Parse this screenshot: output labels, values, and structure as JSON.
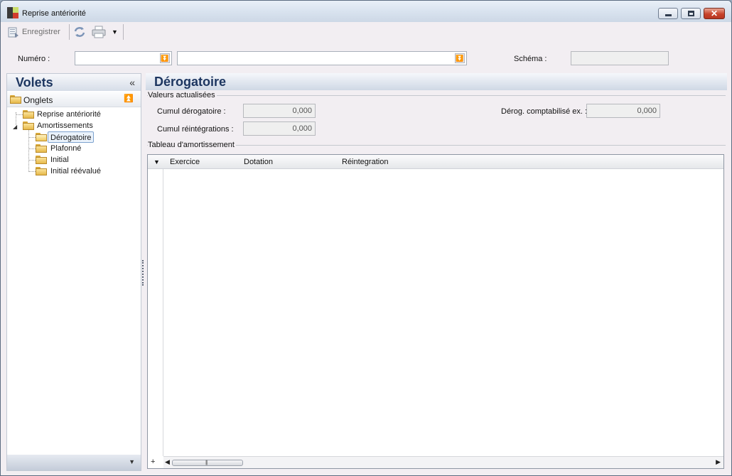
{
  "window": {
    "title": "Reprise antériorité"
  },
  "toolbar": {
    "save_label": "Enregistrer"
  },
  "header": {
    "numero_label": "Numéro :",
    "numero_value": "",
    "numero_desc_value": "",
    "schema_label": "Schéma :",
    "schema_value": ""
  },
  "left_panel": {
    "title": "Volets",
    "tabs_label": "Onglets",
    "tree": {
      "root1": "Reprise antériorité",
      "root2": "Amortissements",
      "children": [
        "Dérogatoire",
        "Plafonné",
        "Initial",
        "Initial réévalué"
      ],
      "selected": "Dérogatoire"
    }
  },
  "main": {
    "title": "Dérogatoire",
    "values_group": "Valeurs actualisées",
    "cumul_derog_label": "Cumul dérogatoire :",
    "cumul_derog_value": "0,000",
    "cumul_reint_label": "Cumul réintégrations :",
    "cumul_reint_value": "0,000",
    "derog_compta_label": "Dérog. comptabilisé ex. :",
    "derog_compta_value": "0,000",
    "table_group": "Tableau d'amortissement",
    "table_columns": [
      "Exercice",
      "Dotation",
      "Réintegration"
    ],
    "table_rows": []
  }
}
